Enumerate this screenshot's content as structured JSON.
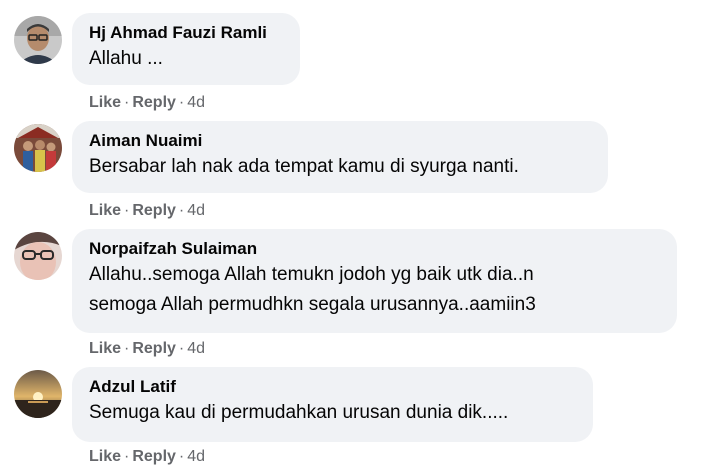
{
  "action_labels": {
    "like": "Like",
    "reply": "Reply",
    "separator": "·"
  },
  "comments": [
    {
      "author": "Hj Ahmad Fauzi Ramli",
      "lines": [
        "Allahu ..."
      ],
      "time": "4d",
      "avatar_icon": "man-with-glasses-avatar"
    },
    {
      "author": "Aiman Nuaimi",
      "lines": [
        "Bersabar lah nak ada tempat kamu di syurga nanti."
      ],
      "time": "4d",
      "avatar_icon": "group-photo-avatar"
    },
    {
      "author": "Norpaifzah Sulaiman",
      "lines": [
        "Allahu..semoga Allah temukn jodoh yg baik utk dia..n",
        "semoga Allah permudhkn segala urusannya..aamiin3"
      ],
      "time": "4d",
      "avatar_icon": "woman-with-glasses-avatar"
    },
    {
      "author": "Adzul Latif",
      "lines": [
        "Semuga kau di permudahkan urusan dunia dik....."
      ],
      "time": "4d",
      "avatar_icon": "sunset-avatar"
    }
  ]
}
